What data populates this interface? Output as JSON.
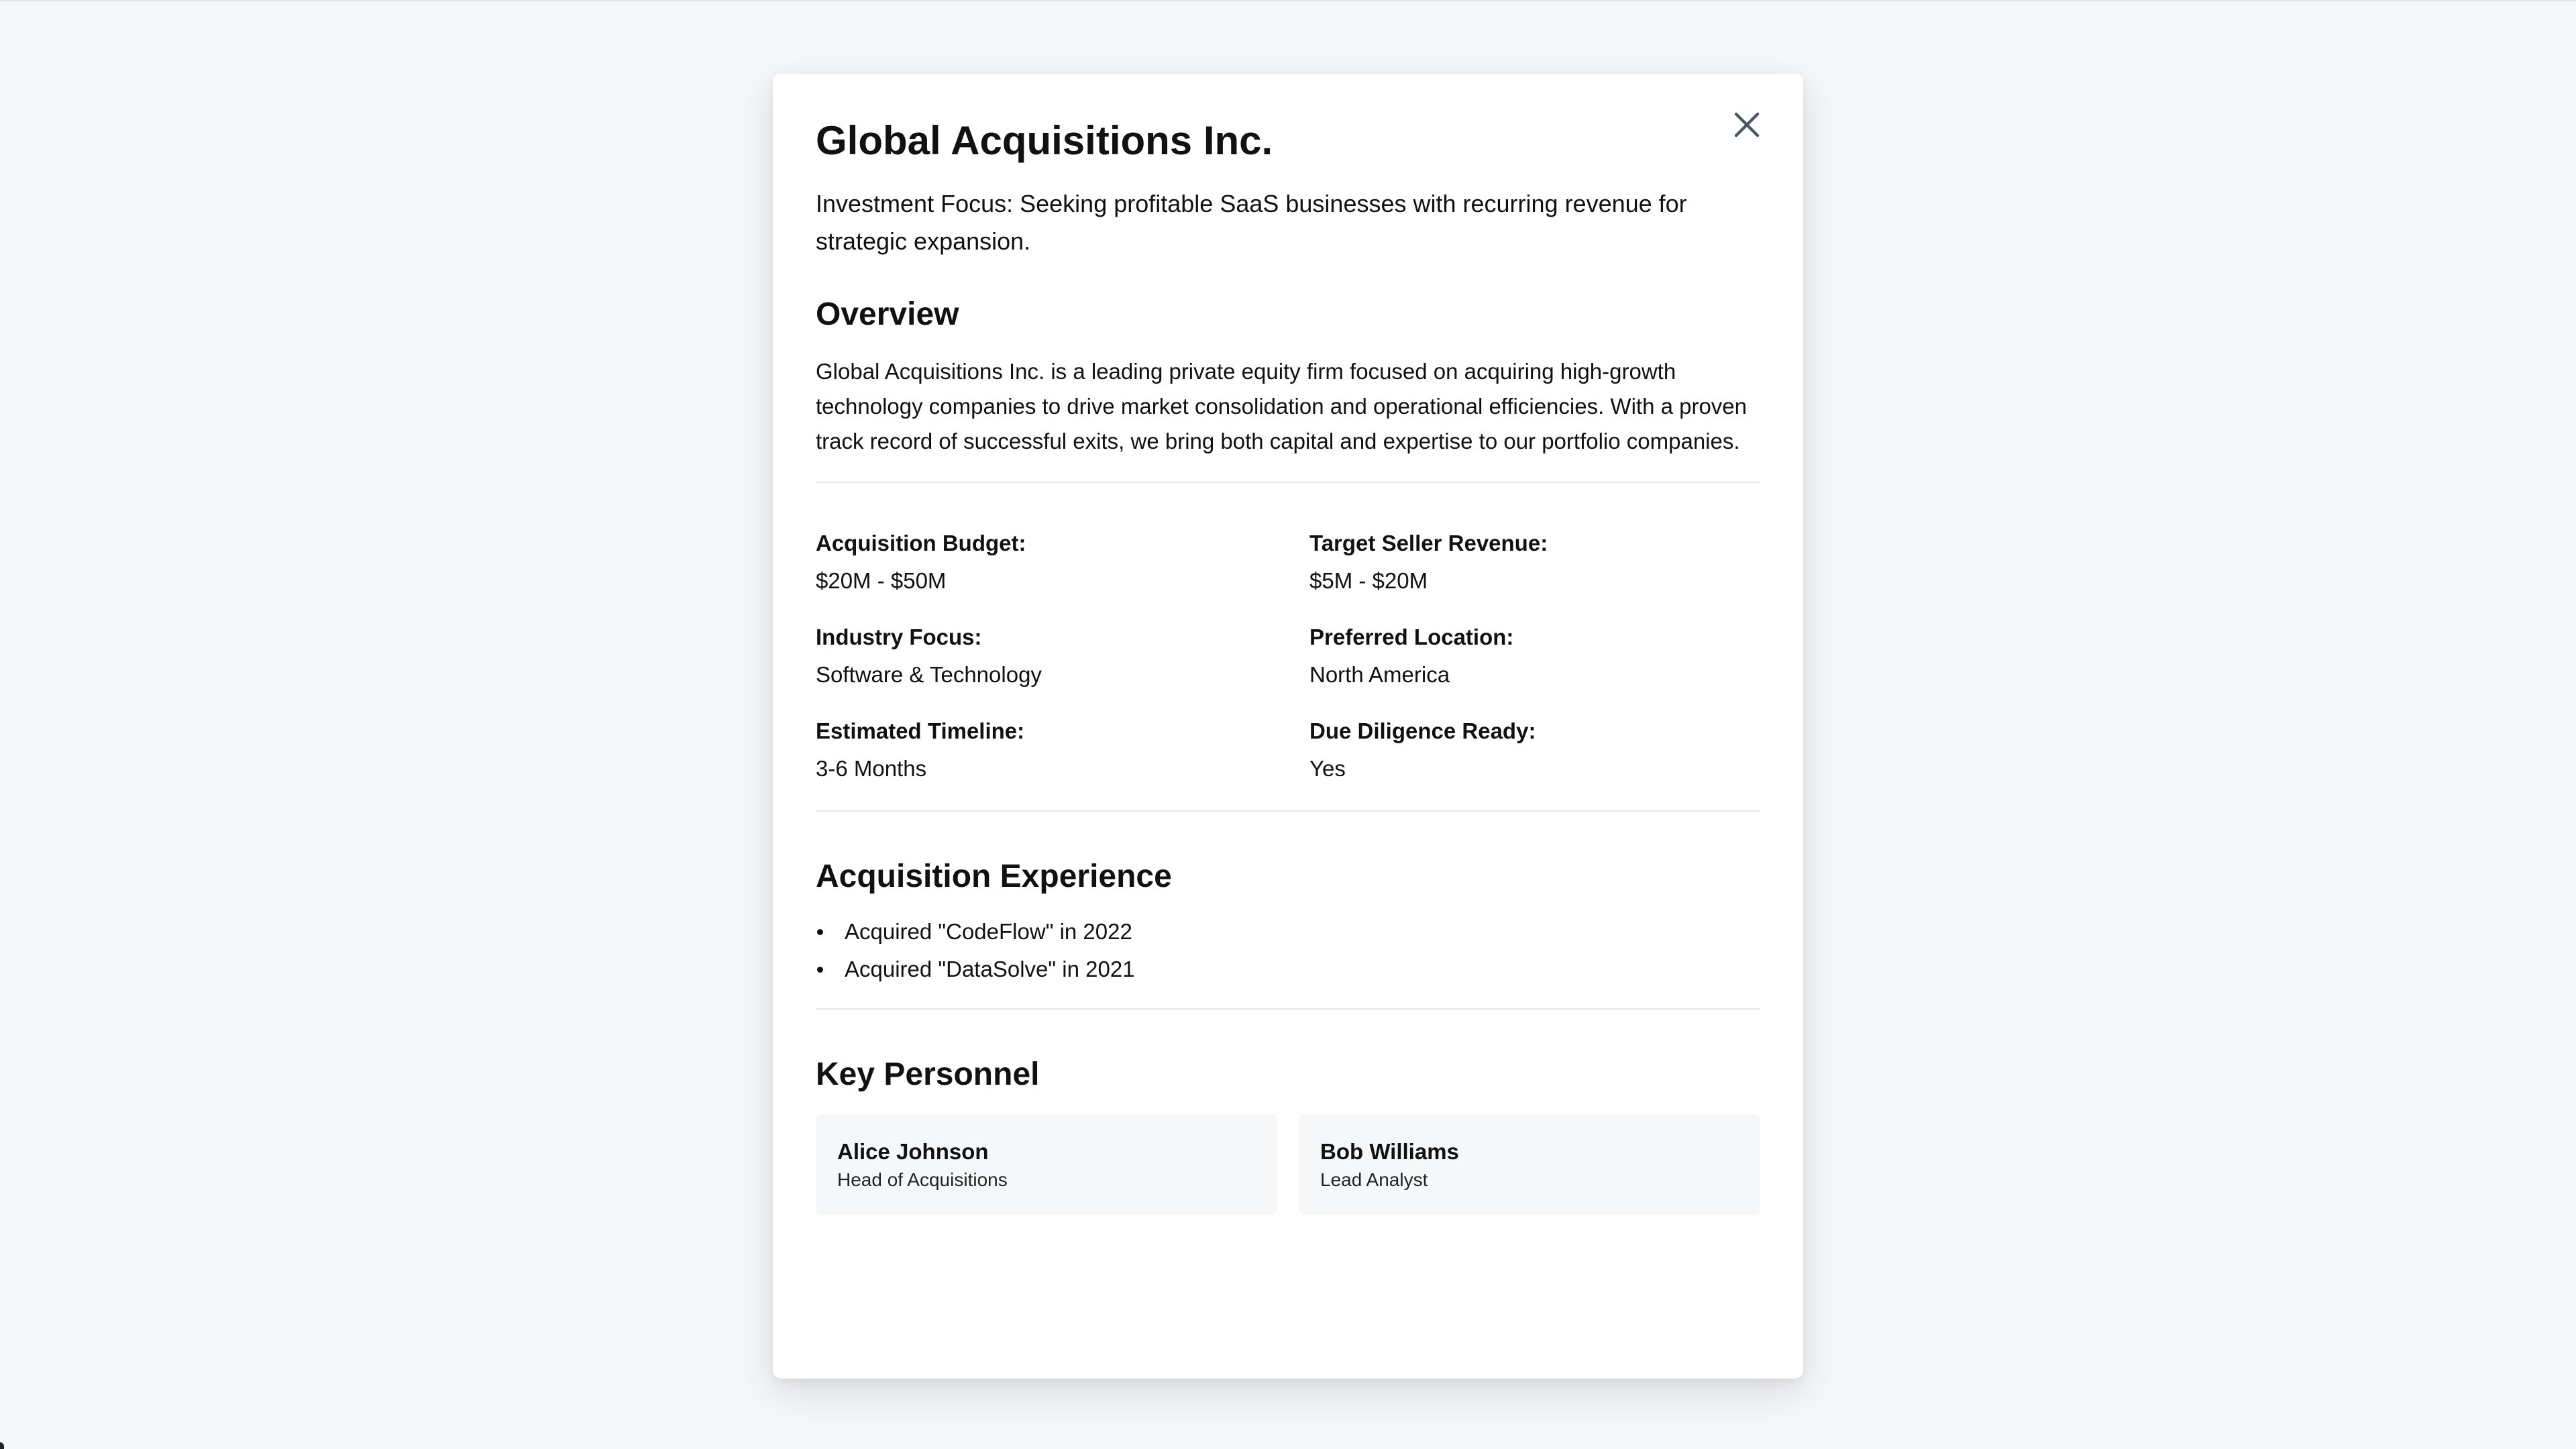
{
  "modal": {
    "title": "Global Acquisitions Inc.",
    "subtitle": "Investment Focus: Seeking profitable SaaS businesses with recurring revenue for strategic expansion.",
    "close_icon": "close-icon",
    "overview": {
      "heading": "Overview",
      "text": "Global Acquisitions Inc. is a leading private equity firm focused on acquiring high-growth technology companies to drive market consolidation and operational efficiencies. With a proven track record of successful exits, we bring both capital and expertise to our portfolio companies."
    },
    "details": [
      {
        "label": "Acquisition Budget:",
        "value": "$20M - $50M"
      },
      {
        "label": "Target Seller Revenue:",
        "value": "$5M - $20M"
      },
      {
        "label": "Industry Focus:",
        "value": "Software & Technology"
      },
      {
        "label": "Preferred Location:",
        "value": "North America"
      },
      {
        "label": "Estimated Timeline:",
        "value": "3-6 Months"
      },
      {
        "label": "Due Diligence Ready:",
        "value": "Yes"
      }
    ],
    "experience": {
      "heading": "Acquisition Experience",
      "items": [
        "Acquired \"CodeFlow\" in 2022",
        "Acquired \"DataSolve\" in 2021"
      ]
    },
    "personnel": {
      "heading": "Key Personnel",
      "people": [
        {
          "name": "Alice Johnson",
          "role": "Head of Acquisitions"
        },
        {
          "name": "Bob Williams",
          "role": "Lead Analyst"
        }
      ]
    }
  },
  "colors": {
    "background": "#f6f7f9",
    "card": "#ffffff",
    "card_muted": "#f6f7f9",
    "divider": "#e5e7eb",
    "close_icon": "#4b5563"
  }
}
